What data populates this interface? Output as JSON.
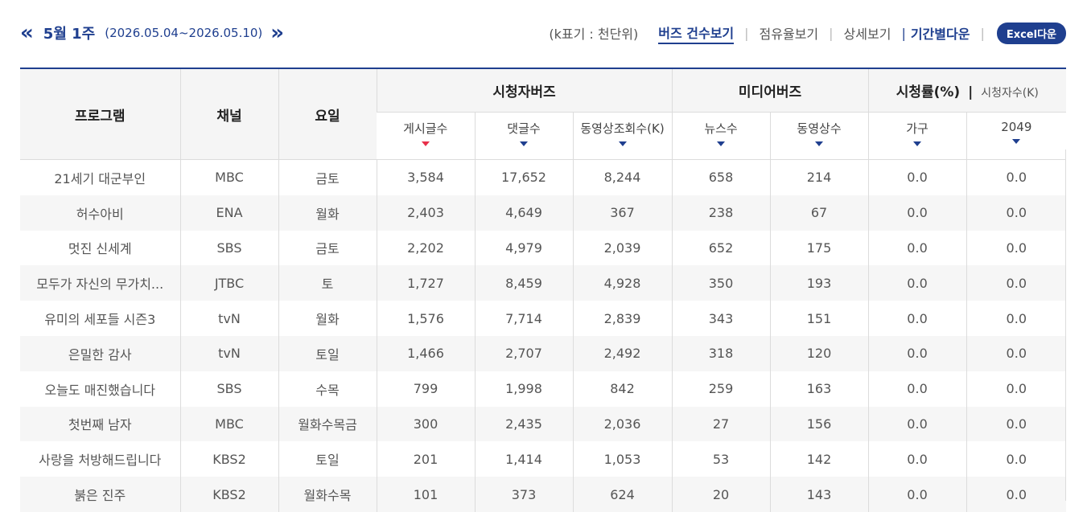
{
  "week": {
    "title": "5월 1주",
    "range": "(2026.05.04~2026.05.10)",
    "prev_icon": "double-left-chevron",
    "next_icon": "double-right-chevron"
  },
  "controls": {
    "unit_note": "(k표기 : 천단위)",
    "buzz_count": "버즈 건수보기",
    "share": "점유율보기",
    "detail": "상세보기",
    "period_download": "기간별다운",
    "excel": "Excel다운"
  },
  "colors": {
    "accent": "#1f3f8f",
    "sort_active": "#e8304a"
  },
  "table": {
    "headers": {
      "program": "프로그램",
      "channel": "채널",
      "day": "요일",
      "viewer_buzz": "시청자버즈",
      "media_buzz": "미디어버즈",
      "ratings": "시청률(%)",
      "viewers": "시청자수(K)"
    },
    "subheaders": {
      "posts": "게시글수",
      "comments": "댓글수",
      "video_views": "동영상조회수(K)",
      "news": "뉴스수",
      "videos": "동영상수",
      "household": "가구",
      "age2049": "2049"
    },
    "rows": [
      {
        "program": "21세기 대군부인",
        "channel": "MBC",
        "day": "금토",
        "posts": "3,584",
        "comments": "17,652",
        "views": "8,244",
        "news": "658",
        "videos": "214",
        "household": "0.0",
        "age2049": "0.0"
      },
      {
        "program": "허수아비",
        "channel": "ENA",
        "day": "월화",
        "posts": "2,403",
        "comments": "4,649",
        "views": "367",
        "news": "238",
        "videos": "67",
        "household": "0.0",
        "age2049": "0.0"
      },
      {
        "program": "멋진 신세계",
        "channel": "SBS",
        "day": "금토",
        "posts": "2,202",
        "comments": "4,979",
        "views": "2,039",
        "news": "652",
        "videos": "175",
        "household": "0.0",
        "age2049": "0.0"
      },
      {
        "program": "모두가 자신의 무가치...",
        "channel": "JTBC",
        "day": "토",
        "posts": "1,727",
        "comments": "8,459",
        "views": "4,928",
        "news": "350",
        "videos": "193",
        "household": "0.0",
        "age2049": "0.0"
      },
      {
        "program": "유미의 세포들 시즌3",
        "channel": "tvN",
        "day": "월화",
        "posts": "1,576",
        "comments": "7,714",
        "views": "2,839",
        "news": "343",
        "videos": "151",
        "household": "0.0",
        "age2049": "0.0"
      },
      {
        "program": "은밀한 감사",
        "channel": "tvN",
        "day": "토일",
        "posts": "1,466",
        "comments": "2,707",
        "views": "2,492",
        "news": "318",
        "videos": "120",
        "household": "0.0",
        "age2049": "0.0"
      },
      {
        "program": "오늘도 매진했습니다",
        "channel": "SBS",
        "day": "수목",
        "posts": "799",
        "comments": "1,998",
        "views": "842",
        "news": "259",
        "videos": "163",
        "household": "0.0",
        "age2049": "0.0"
      },
      {
        "program": "첫번째 남자",
        "channel": "MBC",
        "day": "월화수목금",
        "posts": "300",
        "comments": "2,435",
        "views": "2,036",
        "news": "27",
        "videos": "156",
        "household": "0.0",
        "age2049": "0.0"
      },
      {
        "program": "사랑을 처방해드립니다",
        "channel": "KBS2",
        "day": "토일",
        "posts": "201",
        "comments": "1,414",
        "views": "1,053",
        "news": "53",
        "videos": "142",
        "household": "0.0",
        "age2049": "0.0"
      },
      {
        "program": "붉은 진주",
        "channel": "KBS2",
        "day": "월화수목",
        "posts": "101",
        "comments": "373",
        "views": "624",
        "news": "20",
        "videos": "143",
        "household": "0.0",
        "age2049": "0.0"
      }
    ]
  }
}
